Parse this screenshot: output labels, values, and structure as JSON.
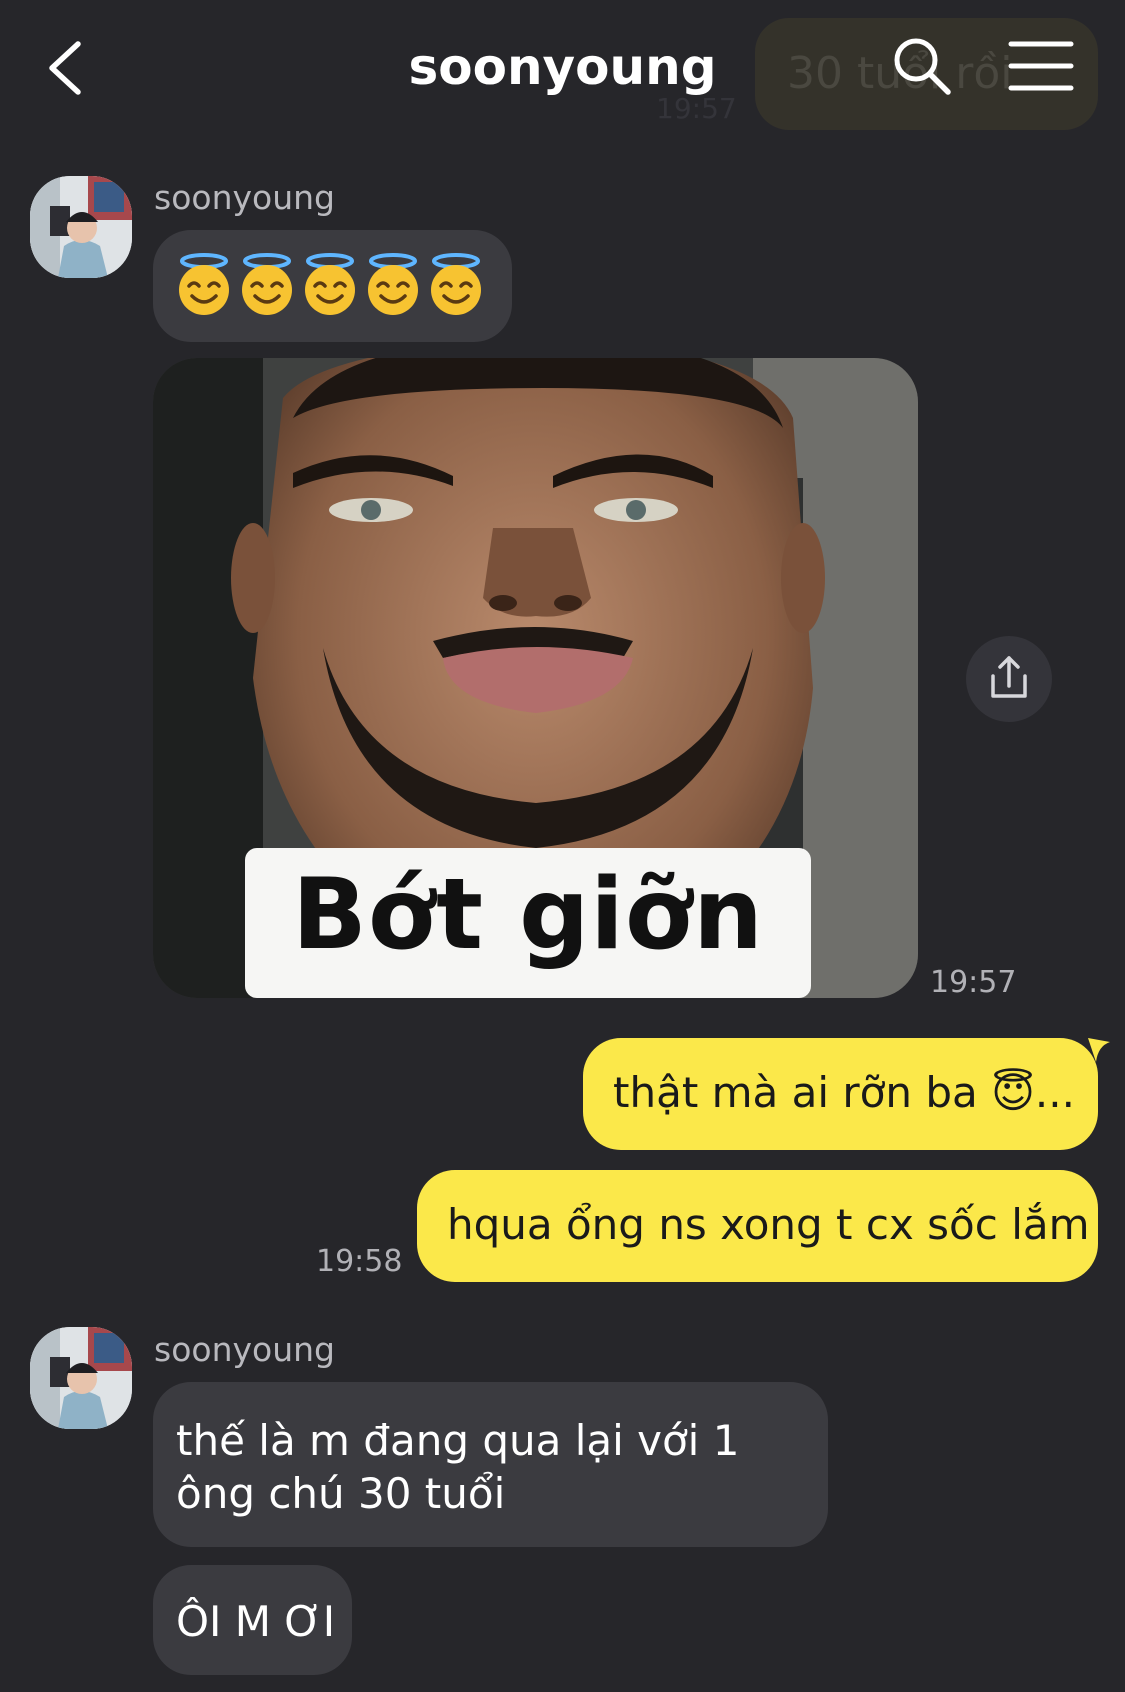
{
  "header": {
    "title": "soonyoung",
    "ghost_message": "30 tuổi rồi",
    "ghost_time": "19:57"
  },
  "messages": {
    "group1": {
      "sender": "soonyoung",
      "emojis": [
        "😇",
        "😇",
        "😇",
        "😇",
        "😇"
      ],
      "image_caption": "Bớt giỡn",
      "time": "19:57"
    },
    "outgoing": {
      "msg1": "thật mà ai rỡn ba 😇...",
      "msg2": "hqua ổng ns xong t cx sốc lắm",
      "time": "19:58"
    },
    "group2": {
      "sender": "soonyoung",
      "msg1": "thế là m đang qua lại với 1 ông chú 30 tuổi",
      "msg2": "ÔI M ƠI"
    }
  },
  "icons": {
    "back": "chevron-left-icon",
    "search": "search-icon",
    "menu": "hamburger-menu-icon",
    "share": "share-upload-icon"
  },
  "colors": {
    "background": "#26262a",
    "incoming_bubble": "#3b3b40",
    "outgoing_bubble": "#fbe84a"
  }
}
